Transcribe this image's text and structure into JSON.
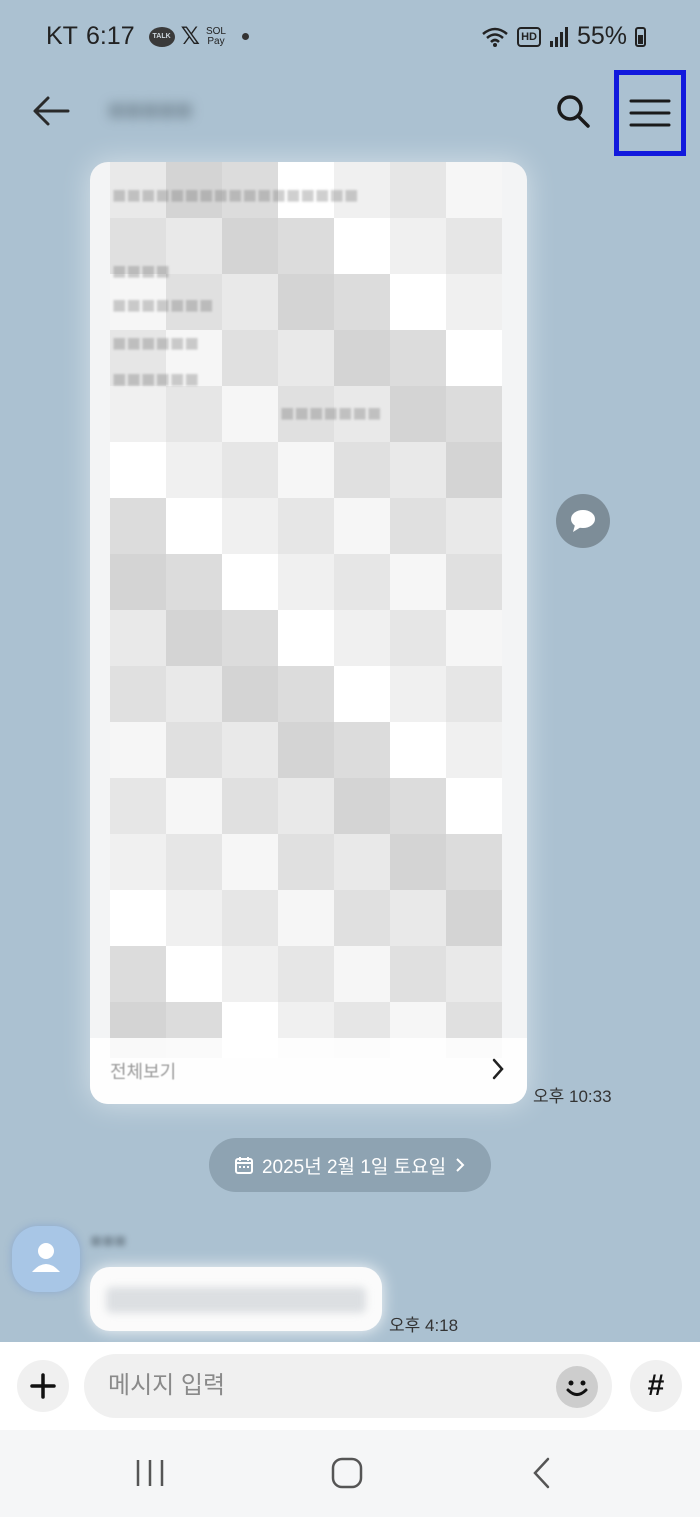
{
  "status_bar": {
    "carrier": "KT",
    "time": "6:17",
    "icons": [
      "kakaotalk-icon",
      "x-icon",
      "sol-pay-icon",
      "dot-icon"
    ],
    "sol_label": "SOL",
    "pay_label": "Pay",
    "talk_label": "TALK",
    "hd_label": "HD",
    "battery": "55%",
    "right_icons": [
      "wifi-icon",
      "hd-voice-icon",
      "signal-icon",
      "battery-icon"
    ]
  },
  "header": {
    "back_icon": "arrow-left-icon",
    "search_icon": "search-icon",
    "menu_icon": "hamburger-menu-icon",
    "highlight_color": "#1119dd"
  },
  "post_card": {
    "view_all_label": "전체보기",
    "timestamp": "오후 10:33"
  },
  "date_divider": {
    "label": "2025년 2월 1일 토요일",
    "calendar_icon": "calendar-icon",
    "chevron_icon": "chevron-right-icon"
  },
  "incoming_message": {
    "timestamp": "오후 4:18",
    "avatar_icon": "default-user-icon"
  },
  "composer": {
    "placeholder": "메시지 입력",
    "plus_icon": "plus-icon",
    "emoji_icon": "emoji-icon",
    "hash_label": "#"
  },
  "nav_bar": {
    "icons": [
      "recents-icon",
      "home-icon",
      "back-icon"
    ]
  },
  "colors": {
    "chat_background": "#abc1d1",
    "date_pill": "#8ea3b2",
    "avatar": "#a8c6e6"
  }
}
